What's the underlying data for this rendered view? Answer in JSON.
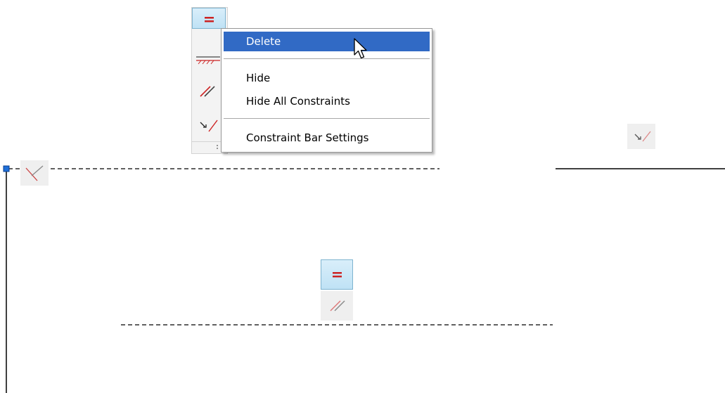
{
  "context_menu": {
    "items": [
      {
        "label": "Delete",
        "highlighted": true
      },
      {
        "label": "Hide",
        "highlighted": false
      },
      {
        "label": "Hide All Constraints",
        "highlighted": false
      },
      {
        "label": "Constraint Bar Settings",
        "highlighted": false
      }
    ]
  },
  "constraint_bars": [
    {
      "name": "top-constraint-bar",
      "buttons": [
        "equal-icon",
        "horizontal-icon",
        "parallel-icon",
        "coincident-icon"
      ],
      "active": "equal-icon"
    },
    {
      "name": "middle-constraint-bar",
      "buttons": [
        "equal-icon",
        "parallel-icon"
      ],
      "active": "equal-icon"
    }
  ],
  "colors": {
    "menu_highlight": "#316ac5",
    "menu_border": "#979797",
    "constraint_red": "#cc2222",
    "selection_grip": "#1e6fd9",
    "active_button_bg": "#cde8f7"
  }
}
